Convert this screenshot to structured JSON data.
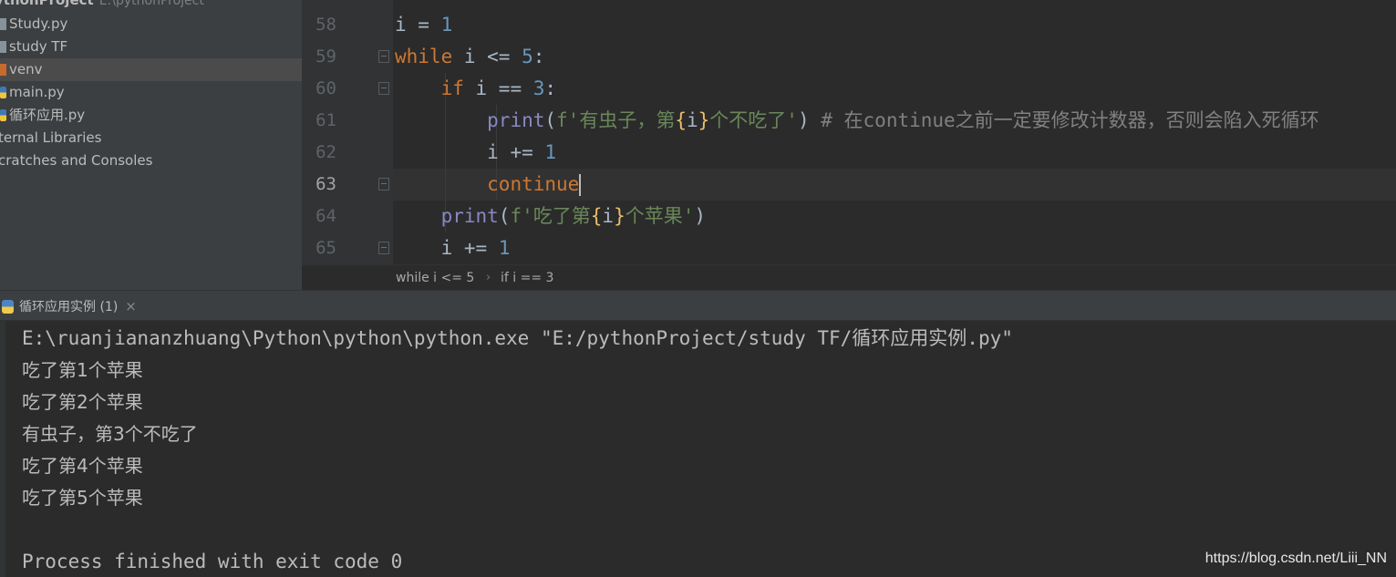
{
  "project": {
    "name": "ythonProject",
    "path": "E:\\pythonProject",
    "items": [
      {
        "label": "Study.py",
        "icon": "folder-icon"
      },
      {
        "label": "study TF",
        "icon": "folder-icon"
      },
      {
        "label": "venv",
        "icon": "folder-excluded-icon",
        "selected": true
      },
      {
        "label": "main.py",
        "icon": "python-file-icon"
      },
      {
        "label": "循环应用.py",
        "icon": "python-file-icon"
      },
      {
        "label": "ternal Libraries",
        "icon": ""
      },
      {
        "label": "cratches and Consoles",
        "icon": ""
      }
    ]
  },
  "editor": {
    "line_numbers": [
      "58",
      "59",
      "60",
      "61",
      "62",
      "63",
      "64",
      "65"
    ],
    "active_line": "63",
    "code": {
      "l58_a": "i",
      "l58_b": " = ",
      "l58_c": "1",
      "l59_kw": "while",
      "l59_b": " i <= ",
      "l59_num": "5",
      "l59_c": ":",
      "l60_kw": "if",
      "l60_b": " i == ",
      "l60_num": "3",
      "l60_c": ":",
      "l61_fn": "print",
      "l61_b": "(",
      "l61_s1": "f'有虫子，第",
      "l61_br1": "{",
      "l61_var": "i",
      "l61_br2": "}",
      "l61_s2": "个不吃了'",
      "l61_c": ")",
      "l61_cm": " # 在continue之前一定要修改计数器，否则会陷入死循环",
      "l62_a": "i += ",
      "l62_num": "1",
      "l63_kw": "continue",
      "l64_fn": "print",
      "l64_b": "(",
      "l64_s1": "f'吃了第",
      "l64_br1": "{",
      "l64_var": "i",
      "l64_br2": "}",
      "l64_s2": "个苹果'",
      "l64_c": ")",
      "l65_a": "i += ",
      "l65_num": "1"
    }
  },
  "breadcrumb": {
    "items": [
      "while i <= 5",
      "if i == 3"
    ],
    "separator": "›"
  },
  "run": {
    "tab_label": "循环应用实例 (1)",
    "close_glyph": "×",
    "output": [
      "E:\\ruanjiananzhuang\\Python\\python\\python.exe \"E:/pythonProject/study TF/循环应用实例.py\"",
      "吃了第1个苹果",
      "吃了第2个苹果",
      "有虫子，第3个不吃了",
      "吃了第4个苹果",
      "吃了第5个苹果",
      "",
      "Process finished with exit code 0"
    ]
  },
  "watermark": "https://blog.csdn.net/Liii_NN",
  "colors": {
    "background": "#2b2b2b",
    "panel": "#3c3f41",
    "keyword": "#cc7832",
    "number": "#6897bb",
    "string": "#6a8759",
    "builtin": "#8888c6",
    "comment": "#808080"
  }
}
